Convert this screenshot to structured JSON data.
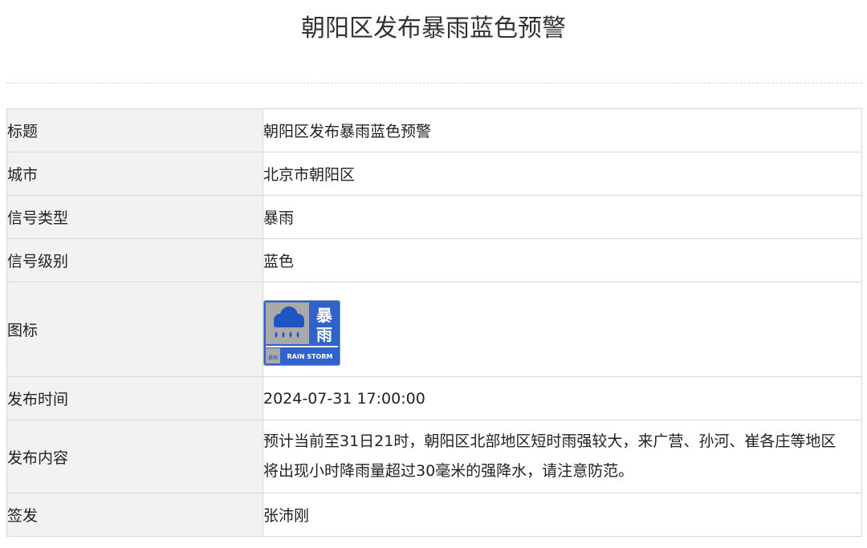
{
  "page": {
    "title": "朝阳区发布暴雨蓝色预警"
  },
  "table": {
    "rows": [
      {
        "label": "标题",
        "value": "朝阳区发布暴雨蓝色预警"
      },
      {
        "label": "城市",
        "value": "北京市朝阳区"
      },
      {
        "label": "信号类型",
        "value": "暴雨"
      },
      {
        "label": "信号级别",
        "value": "蓝色"
      },
      {
        "label": "图标",
        "value": ""
      },
      {
        "label": "发布时间",
        "value": "2024-07-31 17:00:00"
      },
      {
        "label": "发布内容",
        "value": "预计当前至31日21时，朝阳区北部地区短时雨强较大，来广营、孙河、崔各庄等地区将出现小时降雨量超过30毫米的强降水，请注意防范。"
      },
      {
        "label": "签发",
        "value": "张沛刚"
      }
    ]
  },
  "warning_icon": {
    "icon_name": "rainstorm-blue-warning-icon",
    "char_top": "暴",
    "char_bottom": "雨",
    "small_char": "暴雨",
    "english": "RAIN STORM",
    "colors": {
      "blue": "#2f63c9",
      "gray": "#a9a9a9",
      "cloud": "#1e55c4",
      "white": "#ffffff"
    }
  }
}
